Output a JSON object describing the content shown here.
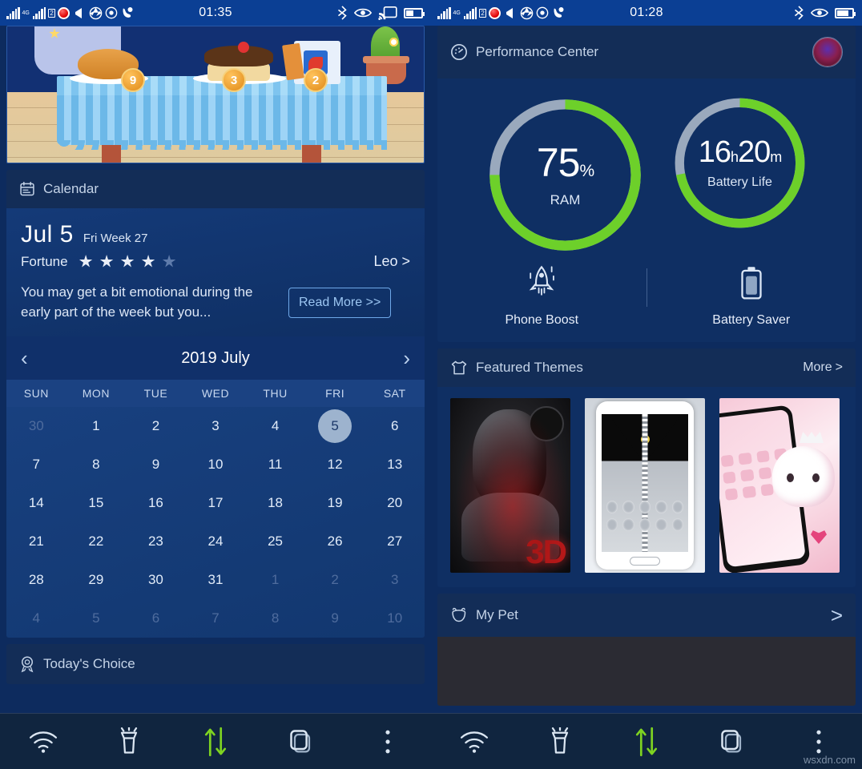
{
  "meta": {
    "watermark": "wsxdn.com"
  },
  "status_bar_left": {
    "time": "01:35",
    "left_icons": [
      "signal-bars-sim1-icon",
      "signal-bars-4g-sim2-icon",
      "sim2-badge-icon",
      "vodafone-icon",
      "volume-mute-icon",
      "camera-aperture-icon",
      "target-icon",
      "call-forward-icon"
    ],
    "right_icons": [
      "bluetooth-icon",
      "eye-care-icon",
      "cast-icon",
      "battery-icon"
    ],
    "sim2_label": "2",
    "network_label": "4G"
  },
  "status_bar_right": {
    "time": "01:28",
    "left_icons": [
      "signal-bars-sim1-icon",
      "signal-bars-4g-sim2-icon",
      "sim2-badge-icon",
      "vodafone-icon",
      "volume-mute-icon",
      "camera-aperture-icon",
      "target-icon",
      "call-forward-icon"
    ],
    "right_icons": [
      "bluetooth-icon",
      "eye-care-icon",
      "battery-icon"
    ],
    "sim2_label": "2",
    "network_label": "4G"
  },
  "pet_scene": {
    "name": "pet-room-scene",
    "items": [
      {
        "name": "bread",
        "badge": "9"
      },
      {
        "name": "cake",
        "badge": "3"
      },
      {
        "name": "gift-box",
        "badge": "2"
      }
    ]
  },
  "calendar_card": {
    "title": "Calendar",
    "icon": "calendar-icon",
    "fortune": {
      "date": "Jul 5",
      "weekday_week": "Fri Week 27",
      "label": "Fortune",
      "stars_filled": 4,
      "stars_total": 5,
      "sign": "Leo",
      "sign_chevron": ">",
      "text": "You may get a bit emotional during the early part of the week but you...",
      "read_more": "Read More >>"
    },
    "month_title": "2019 July",
    "prev_icon": "chevron-left-icon",
    "next_icon": "chevron-right-icon",
    "dow": [
      "SUN",
      "MON",
      "TUE",
      "WED",
      "THU",
      "FRI",
      "SAT"
    ],
    "weeks": [
      [
        {
          "d": "30",
          "muted": true
        },
        {
          "d": "1"
        },
        {
          "d": "2"
        },
        {
          "d": "3"
        },
        {
          "d": "4"
        },
        {
          "d": "5",
          "selected": true
        },
        {
          "d": "6"
        }
      ],
      [
        {
          "d": "7"
        },
        {
          "d": "8"
        },
        {
          "d": "9"
        },
        {
          "d": "10"
        },
        {
          "d": "11"
        },
        {
          "d": "12"
        },
        {
          "d": "13"
        }
      ],
      [
        {
          "d": "14"
        },
        {
          "d": "15"
        },
        {
          "d": "16"
        },
        {
          "d": "17"
        },
        {
          "d": "18"
        },
        {
          "d": "19"
        },
        {
          "d": "20"
        }
      ],
      [
        {
          "d": "21"
        },
        {
          "d": "22"
        },
        {
          "d": "23"
        },
        {
          "d": "24"
        },
        {
          "d": "25"
        },
        {
          "d": "26"
        },
        {
          "d": "27"
        }
      ],
      [
        {
          "d": "28"
        },
        {
          "d": "29"
        },
        {
          "d": "30"
        },
        {
          "d": "31"
        },
        {
          "d": "1",
          "muted": true
        },
        {
          "d": "2",
          "muted": true
        },
        {
          "d": "3",
          "muted": true
        }
      ],
      [
        {
          "d": "4",
          "muted": true
        },
        {
          "d": "5",
          "muted": true
        },
        {
          "d": "6",
          "muted": true
        },
        {
          "d": "7",
          "muted": true
        },
        {
          "d": "8",
          "muted": true
        },
        {
          "d": "9",
          "muted": true
        },
        {
          "d": "10",
          "muted": true
        }
      ]
    ]
  },
  "todays_choice": {
    "title": "Today's Choice",
    "icon": "award-ribbon-icon"
  },
  "performance_center": {
    "title": "Performance Center",
    "icon": "speedometer-icon",
    "avatar": "user-avatar",
    "gauges": [
      {
        "name": "ram-gauge",
        "value": "75",
        "unit": "%",
        "label": "RAM",
        "percent": 75,
        "color": "#6dd02a",
        "track": "#9aa9bd"
      },
      {
        "name": "battery-life-gauge",
        "value_h": "16",
        "unit_h": "h",
        "value_m": "20",
        "unit_m": "m",
        "label": "Battery Life",
        "percent": 72,
        "color": "#6dd02a",
        "track": "#9aa9bd"
      }
    ],
    "actions": [
      {
        "name": "phone-boost",
        "label": "Phone Boost",
        "icon": "rocket-icon"
      },
      {
        "name": "battery-saver",
        "label": "Battery Saver",
        "icon": "battery-icon"
      }
    ]
  },
  "featured_themes": {
    "title": "Featured Themes",
    "icon": "tshirt-icon",
    "more_label": "More",
    "more_chevron": ">",
    "items": [
      {
        "name": "theme-3d-warrior",
        "caption": "3D"
      },
      {
        "name": "theme-diamond-zipper",
        "caption": ""
      },
      {
        "name": "theme-pink-kitty",
        "caption": ""
      }
    ]
  },
  "my_pet": {
    "title": "My Pet",
    "icon": "pet-bear-icon",
    "chevron": ">"
  },
  "bottom_nav": {
    "items": [
      {
        "name": "wifi-toggle",
        "icon": "wifi-icon",
        "active": false
      },
      {
        "name": "flashlight-toggle",
        "icon": "flashlight-icon",
        "active": false
      },
      {
        "name": "data-transfer-toggle",
        "icon": "data-transfer-icon",
        "active": true
      },
      {
        "name": "recent-apps",
        "icon": "copy-stack-icon",
        "active": false
      },
      {
        "name": "more-menu",
        "icon": "overflow-dots-icon",
        "active": false
      }
    ],
    "accent": "#7ed321"
  },
  "colors": {
    "status_bar": "#0b3f94",
    "card_bg": "#0f2f63",
    "card_header": "#132d57",
    "nav_bg": "#10253f",
    "gauge_green": "#6dd02a"
  }
}
